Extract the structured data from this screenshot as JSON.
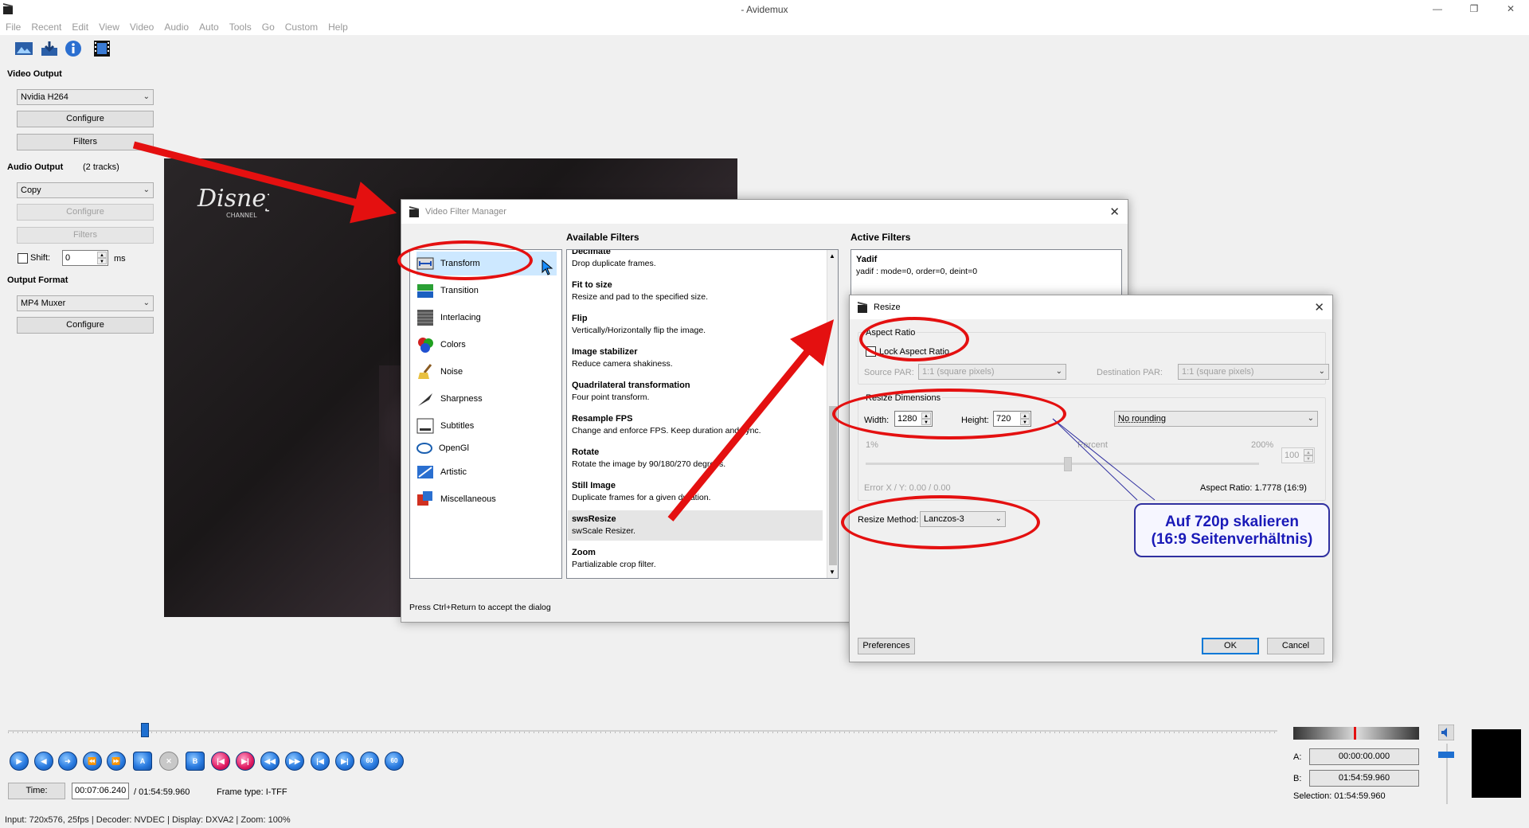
{
  "app": {
    "title": "- Avidemux"
  },
  "menu": [
    "File",
    "Recent",
    "Edit",
    "View",
    "Video",
    "Audio",
    "Auto",
    "Tools",
    "Go",
    "Custom",
    "Help"
  ],
  "left": {
    "video_output_label": "Video Output",
    "video_codec": "Nvidia H264",
    "configure": "Configure",
    "filters": "Filters",
    "audio_output_label": "Audio Output",
    "audio_tracks": "(2 tracks)",
    "audio_codec": "Copy",
    "shift_label": "Shift:",
    "shift_value": "0",
    "shift_unit": "ms",
    "output_format_label": "Output Format",
    "muxer": "MP4 Muxer"
  },
  "filter_manager": {
    "title": "Video Filter Manager",
    "categories": [
      "Transform",
      "Transition",
      "Interlacing",
      "Colors",
      "Noise",
      "Sharpness",
      "Subtitles",
      "OpenGl",
      "Artistic",
      "Miscellaneous"
    ],
    "available_header": "Available Filters",
    "active_header": "Active Filters",
    "filters": [
      {
        "name": "Decimate",
        "desc": "Drop duplicate frames."
      },
      {
        "name": "Fit to size",
        "desc": "Resize and pad to the specified size."
      },
      {
        "name": "Flip",
        "desc": "Vertically/Horizontally flip the image."
      },
      {
        "name": "Image stabilizer",
        "desc": "Reduce camera shakiness."
      },
      {
        "name": "Quadrilateral transformation",
        "desc": "Four point transform."
      },
      {
        "name": "Resample FPS",
        "desc": "Change and enforce FPS. Keep duration and sync."
      },
      {
        "name": "Rotate",
        "desc": "Rotate the image by 90/180/270 degrees."
      },
      {
        "name": "Still Image",
        "desc": "Duplicate frames for a given duration."
      },
      {
        "name": "swsResize",
        "desc": "swScale Resizer."
      },
      {
        "name": "Zoom",
        "desc": "Partializable crop filter."
      }
    ],
    "active": [
      {
        "name": "Yadif",
        "desc": "yadif : mode=0, order=0, deint=0"
      }
    ],
    "hint": "Press Ctrl+Return to accept the dialog"
  },
  "resize": {
    "title": "Resize",
    "aspect_ratio_group": "Aspect Ratio",
    "lock_aspect": "Lock Aspect Ratio",
    "source_par_label": "Source PAR:",
    "source_par": "1:1 (square pixels)",
    "dest_par_label": "Destination PAR:",
    "dest_par": "1:1 (square pixels)",
    "dimensions_group": "Resize Dimensions",
    "width_label": "Width:",
    "width": "1280",
    "height_label": "Height:",
    "height": "720",
    "rounding": "No rounding",
    "pct_min": "1%",
    "pct_label": "Percent",
    "pct_max": "200%",
    "pct_value": "100",
    "error_xy": "Error X / Y:  0.00 / 0.00",
    "aspect_ratio_text": "Aspect Ratio:  1.7778  (16:9)",
    "method_label": "Resize Method:",
    "method": "Lanczos-3",
    "preferences": "Preferences",
    "ok": "OK",
    "cancel": "Cancel"
  },
  "callout": {
    "line1": "Auf 720p skalieren",
    "line2": "(16:9 Seitenverhältnis)"
  },
  "player": {
    "time_label": "Time:",
    "time": "00:07:06.240",
    "duration": "/ 01:54:59.960",
    "frame_type": "Frame type:  I-TFF",
    "a_label": "A:",
    "a_time": "00:00:00.000",
    "b_label": "B:",
    "b_time": "01:54:59.960",
    "selection": "Selection: 01:54:59.960",
    "position": 0.108
  },
  "status": "Input: 720x576, 25fps  |  Decoder: NVDEC  |  Display: DXVA2  |  Zoom: 100%"
}
